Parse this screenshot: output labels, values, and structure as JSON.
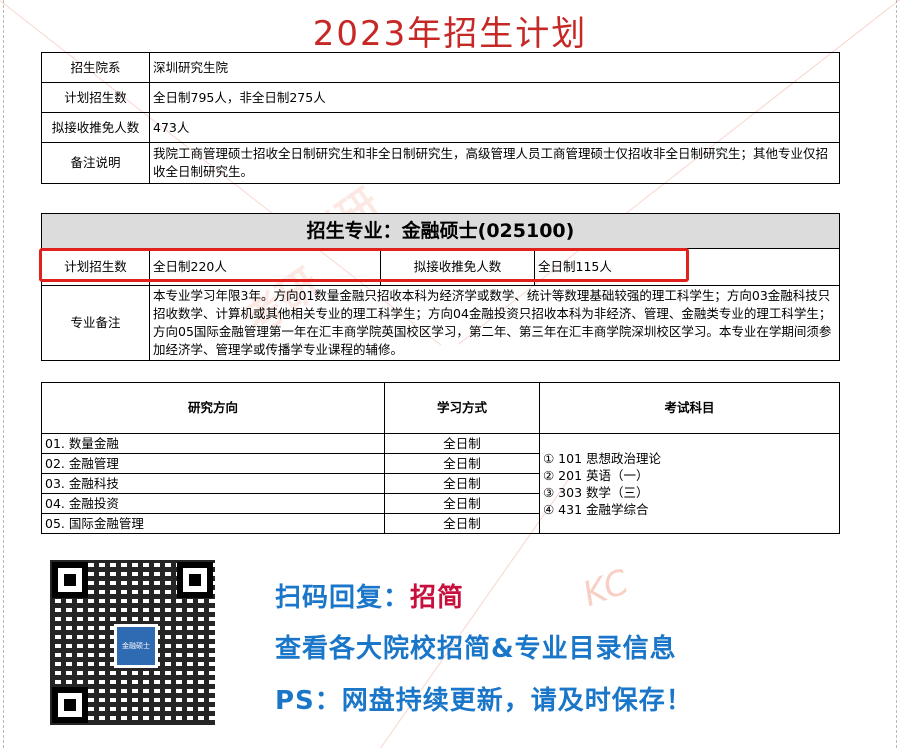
{
  "title": "2023年招生计划",
  "school": {
    "rows": [
      {
        "label": "招生院系",
        "value": "深圳研究生院"
      },
      {
        "label": "计划招生数",
        "value": "全日制795人，非全日制275人"
      },
      {
        "label": "拟接收推免人数",
        "value": "473人"
      },
      {
        "label": "备注说明",
        "value": "我院工商管理硕士招收全日制研究生和非全日制研究生，高级管理人员工商管理硕士仅招收非全日制研究生；其他专业仅招收全日制研究生。"
      }
    ]
  },
  "major": {
    "heading": "招生专业：金融硕士(025100)",
    "plan_label": "计划招生数",
    "plan_value": "全日制220人",
    "exempt_label": "拟接收推免人数",
    "exempt_value": "全日制115人",
    "note_label": "专业备注",
    "note_value": "本专业学习年限3年。方向01数量金融只招收本科为经济学或数学、统计等数理基础较强的理工科学生；方向03金融科技只招收数学、计算机或其他相关专业的理工科学生；方向04金融投资只招收本科为非经济、管理、金融类专业的理工科学生；方向05国际金融管理第一年在汇丰商学院英国校区学习，第二年、第三年在汇丰商学院深圳校区学习。本专业在学期间须参加经济学、管理学或传播学专业课程的辅修。"
  },
  "directions": {
    "headers": [
      "研究方向",
      "学习方式",
      "考试科目"
    ],
    "rows": [
      {
        "name": "01. 数量金融",
        "mode": "全日制"
      },
      {
        "name": "02. 金融管理",
        "mode": "全日制"
      },
      {
        "name": "03. 金融科技",
        "mode": "全日制"
      },
      {
        "name": "04. 金融投资",
        "mode": "全日制"
      },
      {
        "name": "05. 国际金融管理",
        "mode": "全日制"
      }
    ],
    "subjects": [
      "① 101 思想政治理论",
      "② 201 英语（一）",
      "③ 303 数学（三）",
      "④ 431 金融学综合"
    ]
  },
  "promo": {
    "line1_prefix": "扫码回复：",
    "line1_keyword": "招简",
    "line2": "查看各大院校招简&专业目录信息",
    "line3": "PS：网盘持续更新，请及时保存！"
  },
  "qr_logo_text": "金融硕士",
  "colors": {
    "title": "#c62826",
    "highlight": "#e0211e",
    "promo_blue": "#1a76c8",
    "promo_red": "#c8103d"
  }
}
